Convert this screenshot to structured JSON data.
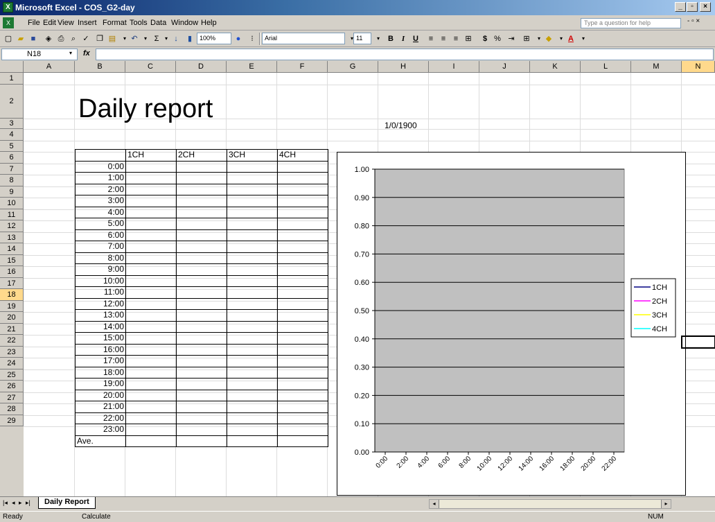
{
  "window": {
    "title": "Microsoft Excel - COS_G2-day",
    "app_icon": "excel-icon"
  },
  "menu": [
    "File",
    "Edit",
    "View",
    "Insert",
    "Format",
    "Tools",
    "Data",
    "Window",
    "Help"
  ],
  "help_placeholder": "Type a question for help",
  "toolbar": {
    "zoom": "100%",
    "font": "Arial",
    "font_size": "11",
    "bold": "B",
    "italic": "I",
    "underline": "U",
    "currency": "$",
    "percent": "%"
  },
  "formula_bar": {
    "name_box": "N18",
    "fx": "fx",
    "value": ""
  },
  "columns": [
    "A",
    "B",
    "C",
    "D",
    "E",
    "F",
    "G",
    "H",
    "I",
    "J",
    "K",
    "L",
    "M",
    "N"
  ],
  "rows": [
    "1",
    "2",
    "3",
    "4",
    "5",
    "6",
    "7",
    "8",
    "9",
    "10",
    "11",
    "12",
    "13",
    "14",
    "15",
    "16",
    "17",
    "18",
    "19",
    "20",
    "21",
    "22",
    "23",
    "24",
    "25",
    "26",
    "27",
    "28",
    "29"
  ],
  "sheet": {
    "title": "Daily report",
    "date": "1/0/1900",
    "headers": [
      "1CH",
      "2CH",
      "3CH",
      "4CH"
    ],
    "times": [
      "0:00",
      "1:00",
      "2:00",
      "3:00",
      "4:00",
      "5:00",
      "6:00",
      "7:00",
      "8:00",
      "9:00",
      "10:00",
      "11:00",
      "12:00",
      "13:00",
      "14:00",
      "15:00",
      "16:00",
      "17:00",
      "18:00",
      "19:00",
      "20:00",
      "21:00",
      "22:00",
      "23:00"
    ],
    "average_label": "Ave."
  },
  "chart_data": {
    "type": "line",
    "x": [
      "0:00",
      "2:00",
      "4:00",
      "6:00",
      "8:00",
      "10:00",
      "12:00",
      "14:00",
      "16:00",
      "18:00",
      "20:00",
      "22:00"
    ],
    "series": [
      {
        "name": "1CH",
        "color": "#000080",
        "values": []
      },
      {
        "name": "2CH",
        "color": "#ff00ff",
        "values": []
      },
      {
        "name": "3CH",
        "color": "#ffff00",
        "values": []
      },
      {
        "name": "4CH",
        "color": "#00ffff",
        "values": []
      }
    ],
    "yticks": [
      "1.00",
      "0.90",
      "0.80",
      "0.70",
      "0.60",
      "0.50",
      "0.40",
      "0.30",
      "0.20",
      "0.10",
      "0.00"
    ],
    "ylim": [
      0,
      1
    ],
    "grid": true,
    "legend": "right",
    "plot_color": "#c0c0c0"
  },
  "tabs": {
    "active": "Daily Report"
  },
  "status": {
    "left": "Ready",
    "middle": "Calculate",
    "right": "NUM"
  }
}
